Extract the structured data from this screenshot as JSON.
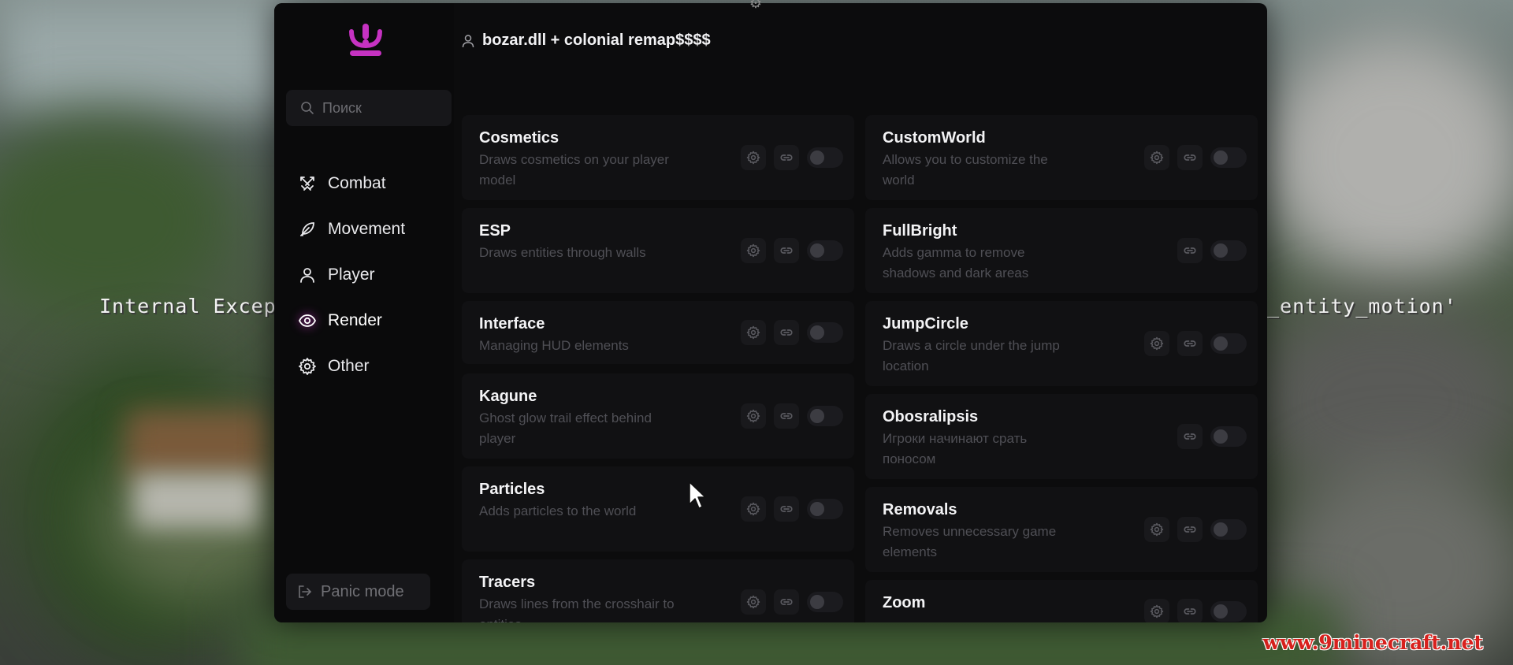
{
  "background": {
    "chat_left": "Internal Exceptic",
    "chat_right": "_entity_motion'",
    "watermark": "www.9minecraft.net"
  },
  "client": {
    "title": "bozar.dll + colonial remap$$$$",
    "logo_icon": "crown-logo-icon",
    "accent_color": "#c632c2",
    "search": {
      "placeholder": "Поиск",
      "value": ""
    },
    "categories": [
      {
        "label": "Combat",
        "icon": "swords-icon"
      },
      {
        "label": "Movement",
        "icon": "feather-icon"
      },
      {
        "label": "Player",
        "icon": "user-icon"
      },
      {
        "label": "Render",
        "icon": "eye-icon",
        "active": true
      },
      {
        "label": "Other",
        "icon": "gear-icon"
      }
    ],
    "panic_label": "Panic mode",
    "modules_left": [
      {
        "name": "Cosmetics",
        "desc": "Draws cosmetics on your player model",
        "settings": true,
        "enabled": false
      },
      {
        "name": "ESP",
        "desc": "Draws entities through walls",
        "settings": true,
        "enabled": false
      },
      {
        "name": "Interface",
        "desc": "Managing HUD elements",
        "settings": true,
        "enabled": false
      },
      {
        "name": "Kagune",
        "desc": "Ghost glow trail effect behind player",
        "settings": true,
        "enabled": false
      },
      {
        "name": "Particles",
        "desc": "Adds particles to the world",
        "settings": true,
        "enabled": false
      },
      {
        "name": "Tracers",
        "desc": "Draws lines from the crosshair to entities",
        "settings": true,
        "enabled": false
      }
    ],
    "modules_right": [
      {
        "name": "CustomWorld",
        "desc": "Allows you to customize the world",
        "settings": true,
        "enabled": false
      },
      {
        "name": "FullBright",
        "desc": "Adds gamma to remove shadows and dark areas",
        "settings": false,
        "enabled": false
      },
      {
        "name": "JumpCircle",
        "desc": "Draws a circle under the jump location",
        "settings": true,
        "enabled": false
      },
      {
        "name": "Obosralipsis",
        "desc": "Игроки начинают срать поносом",
        "settings": false,
        "enabled": false
      },
      {
        "name": "Removals",
        "desc": "Removes unnecessary game elements",
        "settings": true,
        "enabled": false
      },
      {
        "name": "Zoom",
        "desc": "",
        "settings": true,
        "enabled": false
      }
    ]
  }
}
